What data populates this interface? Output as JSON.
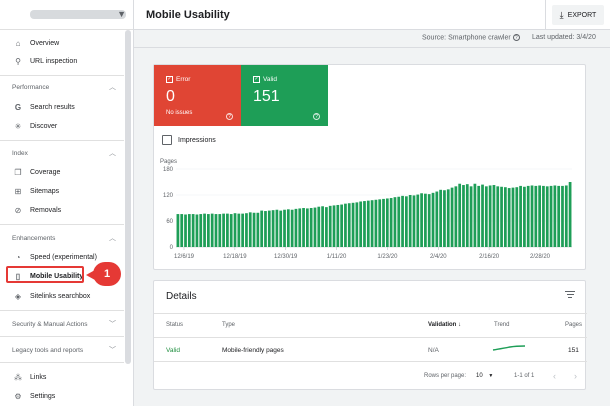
{
  "sidebar": {
    "top_items": [
      {
        "label": "Overview",
        "icon": "home-icon"
      },
      {
        "label": "URL inspection",
        "icon": "search-icon"
      }
    ],
    "sections": [
      {
        "title": "Performance",
        "items": [
          {
            "label": "Search results",
            "icon": "google-icon"
          },
          {
            "label": "Discover",
            "icon": "asterisk-icon"
          }
        ]
      },
      {
        "title": "Index",
        "items": [
          {
            "label": "Coverage",
            "icon": "copy-icon"
          },
          {
            "label": "Sitemaps",
            "icon": "sitemap-icon"
          },
          {
            "label": "Removals",
            "icon": "eye-off-icon"
          }
        ]
      },
      {
        "title": "Enhancements",
        "items": [
          {
            "label": "Speed (experimental)",
            "icon": "speed-icon"
          },
          {
            "label": "Mobile Usability",
            "icon": "phone-icon"
          },
          {
            "label": "Sitelinks searchbox",
            "icon": "diamond-icon"
          }
        ]
      }
    ],
    "collapsed_sections": [
      "Security & Manual Actions",
      "Legacy tools and reports"
    ],
    "bottom_items": [
      {
        "label": "Links",
        "icon": "links-icon"
      },
      {
        "label": "Settings",
        "icon": "settings-icon"
      }
    ],
    "callout_number": "1"
  },
  "header": {
    "title": "Mobile Usability",
    "export_label": "EXPORT"
  },
  "meta": {
    "source": "Source: Smartphone crawler",
    "updated": "Last updated: 3/4/20"
  },
  "tiles": {
    "error": {
      "label": "Error",
      "value": "0",
      "sub": "No issues",
      "color": "#e04534"
    },
    "valid": {
      "label": "Valid",
      "value": "151",
      "color": "#1e9e57"
    }
  },
  "impressions_label": "Impressions",
  "chart_data": {
    "type": "bar",
    "ylabel": "Pages",
    "yticks": [
      0,
      60,
      120,
      180
    ],
    "ylim": [
      0,
      180
    ],
    "xticks": [
      "12/6/19",
      "12/18/19",
      "12/30/19",
      "1/11/20",
      "1/23/20",
      "2/4/20",
      "2/16/20",
      "2/28/20"
    ],
    "color": "#1e9e57",
    "values": [
      76,
      76,
      75,
      76,
      76,
      75,
      76,
      77,
      76,
      77,
      76,
      76,
      77,
      77,
      76,
      78,
      77,
      77,
      78,
      80,
      79,
      79,
      84,
      83,
      84,
      85,
      86,
      84,
      86,
      87,
      86,
      88,
      89,
      90,
      89,
      90,
      91,
      93,
      94,
      92,
      95,
      96,
      97,
      98,
      100,
      101,
      102,
      103,
      105,
      106,
      107,
      108,
      109,
      110,
      111,
      112,
      113,
      115,
      116,
      118,
      117,
      120,
      119,
      121,
      124,
      123,
      122,
      125,
      128,
      132,
      131,
      133,
      137,
      140,
      146,
      143,
      145,
      140,
      146,
      141,
      144,
      140,
      142,
      143,
      140,
      139,
      138,
      136,
      137,
      138,
      141,
      139,
      141,
      142,
      141,
      142,
      141,
      140,
      141,
      142,
      141,
      141,
      142,
      150
    ]
  },
  "details": {
    "title": "Details",
    "columns": {
      "status": "Status",
      "type": "Type",
      "validation": "Validation",
      "trend": "Trend",
      "pages": "Pages"
    },
    "sort_arrow": "↓",
    "row": {
      "status": "Valid",
      "type": "Mobile-friendly pages",
      "validation": "N/A",
      "pages": "151"
    },
    "pager": {
      "rows_label": "Rows per page:",
      "rows_value": "10",
      "range": "1-1 of 1"
    }
  }
}
